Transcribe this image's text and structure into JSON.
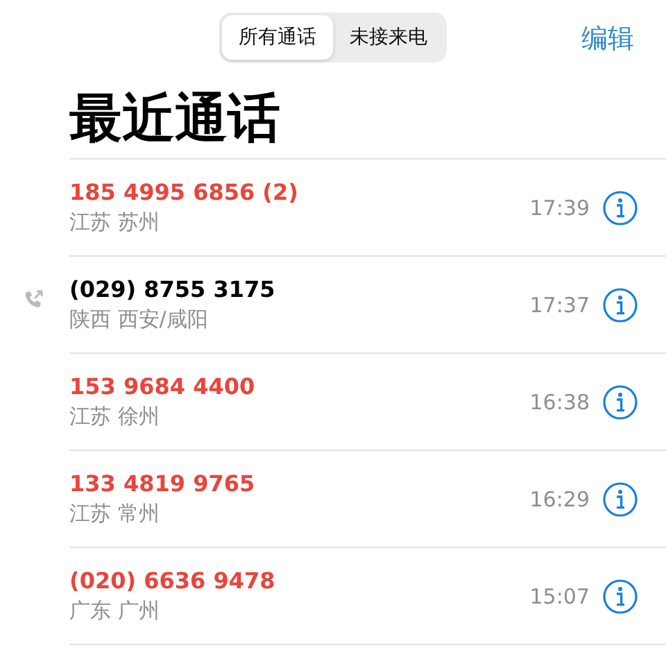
{
  "segments": [
    {
      "label": "所有通话",
      "selected": true
    },
    {
      "label": "未接来电",
      "selected": false
    }
  ],
  "edit_button": "编辑",
  "title": "最近通话",
  "calls": [
    {
      "number": "185 4995 6856 (2)",
      "location": "江苏 苏州",
      "time": "17:39",
      "missed": true,
      "outgoing": false
    },
    {
      "number": "(029) 8755 3175",
      "location": "陕西 西安/咸阳",
      "time": "17:37",
      "missed": false,
      "outgoing": true
    },
    {
      "number": "153 9684 4400",
      "location": "江苏 徐州",
      "time": "16:38",
      "missed": true,
      "outgoing": false
    },
    {
      "number": "133 4819 9765",
      "location": "江苏 常州",
      "time": "16:29",
      "missed": true,
      "outgoing": false
    },
    {
      "number": "(020) 6636 9478",
      "location": "广东 广州",
      "time": "15:07",
      "missed": true,
      "outgoing": false
    }
  ]
}
